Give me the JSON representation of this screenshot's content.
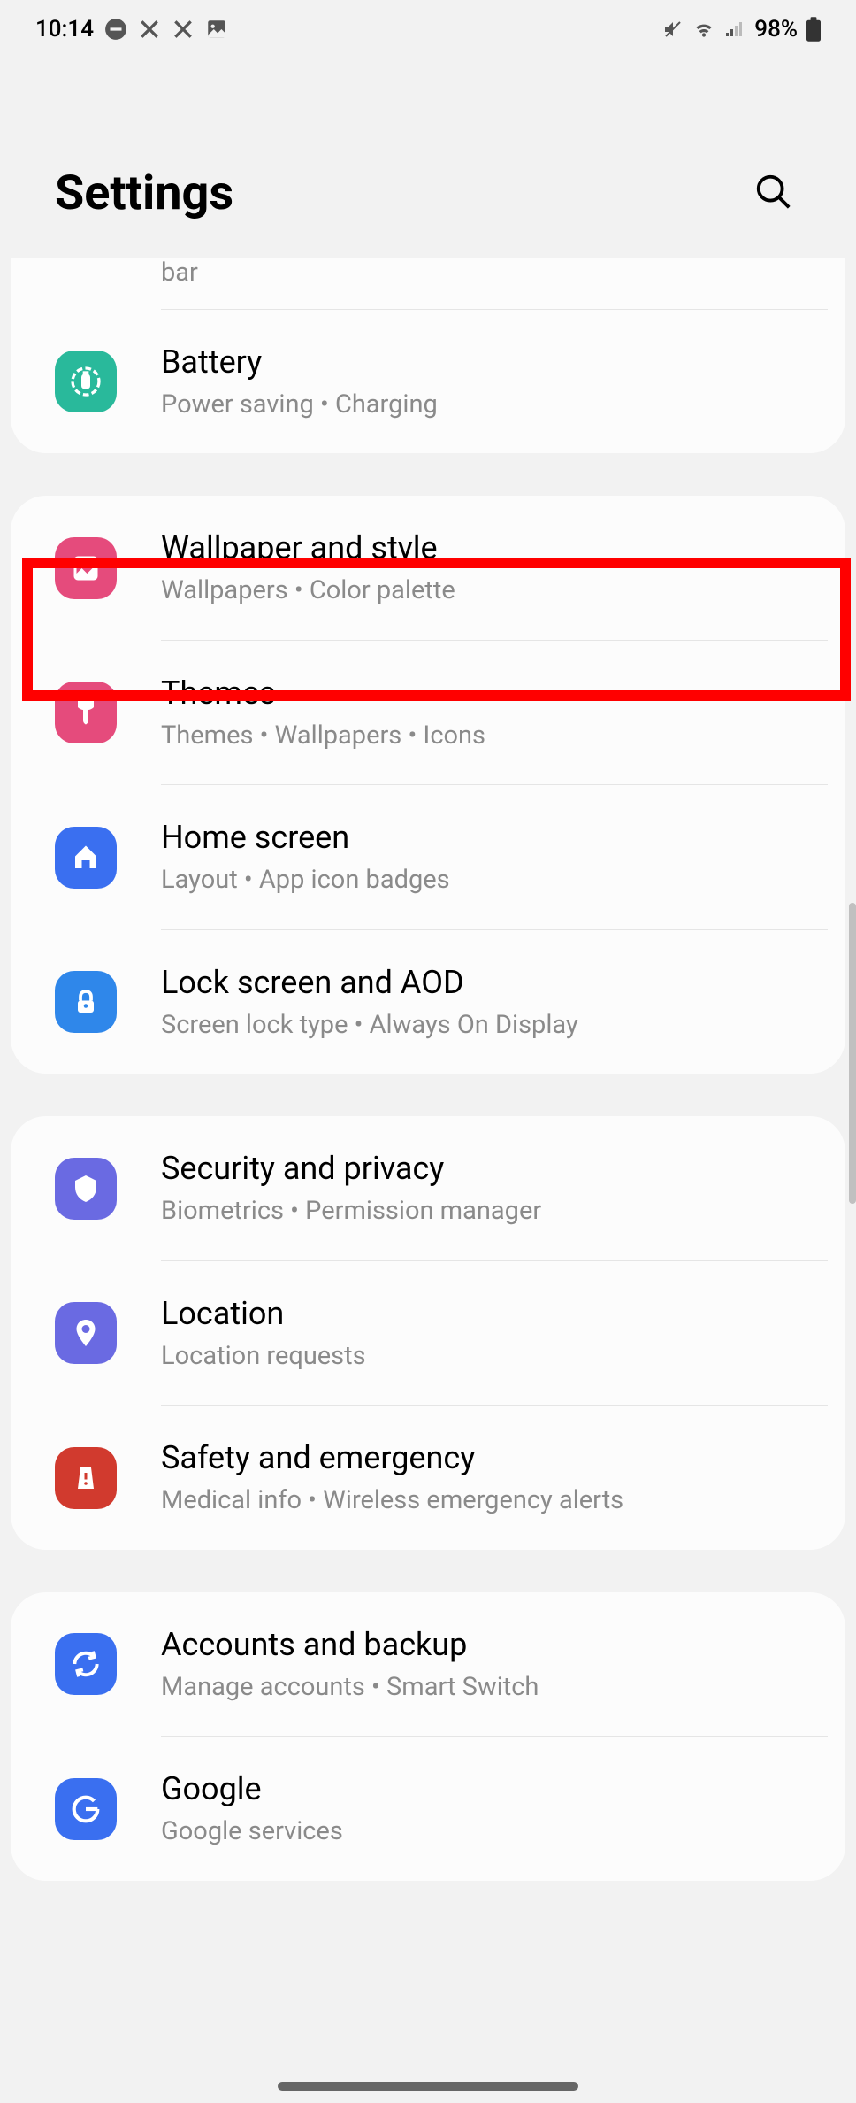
{
  "statusBar": {
    "time": "10:14",
    "battery": "98%"
  },
  "header": {
    "title": "Settings"
  },
  "groups": [
    {
      "partial": true,
      "partialText": "bar",
      "items": [
        {
          "icon": "battery-icon",
          "iconBg": "#29b99b",
          "title": "Battery",
          "subtitle": "Power saving  •  Charging"
        }
      ]
    },
    {
      "items": [
        {
          "icon": "wallpaper-icon",
          "iconBg": "#e54b7c",
          "title": "Wallpaper and style",
          "subtitle": "Wallpapers  •  Color palette",
          "highlighted": true
        },
        {
          "icon": "themes-icon",
          "iconBg": "#e54b7c",
          "title": "Themes",
          "subtitle": "Themes  •  Wallpapers  •  Icons"
        },
        {
          "icon": "home-icon",
          "iconBg": "#3a6ff0",
          "title": "Home screen",
          "subtitle": "Layout  •  App icon badges"
        },
        {
          "icon": "lock-icon",
          "iconBg": "#2f87ea",
          "title": "Lock screen and AOD",
          "subtitle": "Screen lock type  •  Always On Display"
        }
      ]
    },
    {
      "items": [
        {
          "icon": "shield-icon",
          "iconBg": "#6a6ae2",
          "title": "Security and privacy",
          "subtitle": "Biometrics  •  Permission manager"
        },
        {
          "icon": "location-icon",
          "iconBg": "#6a6ae2",
          "title": "Location",
          "subtitle": "Location requests"
        },
        {
          "icon": "emergency-icon",
          "iconBg": "#d13a2e",
          "title": "Safety and emergency",
          "subtitle": "Medical info  •  Wireless emergency alerts"
        }
      ]
    },
    {
      "items": [
        {
          "icon": "accounts-icon",
          "iconBg": "#3a6ff0",
          "title": "Accounts and backup",
          "subtitle": "Manage accounts  •  Smart Switch"
        },
        {
          "icon": "google-icon",
          "iconBg": "#3a6ff0",
          "title": "Google",
          "subtitle": "Google services"
        }
      ]
    }
  ]
}
